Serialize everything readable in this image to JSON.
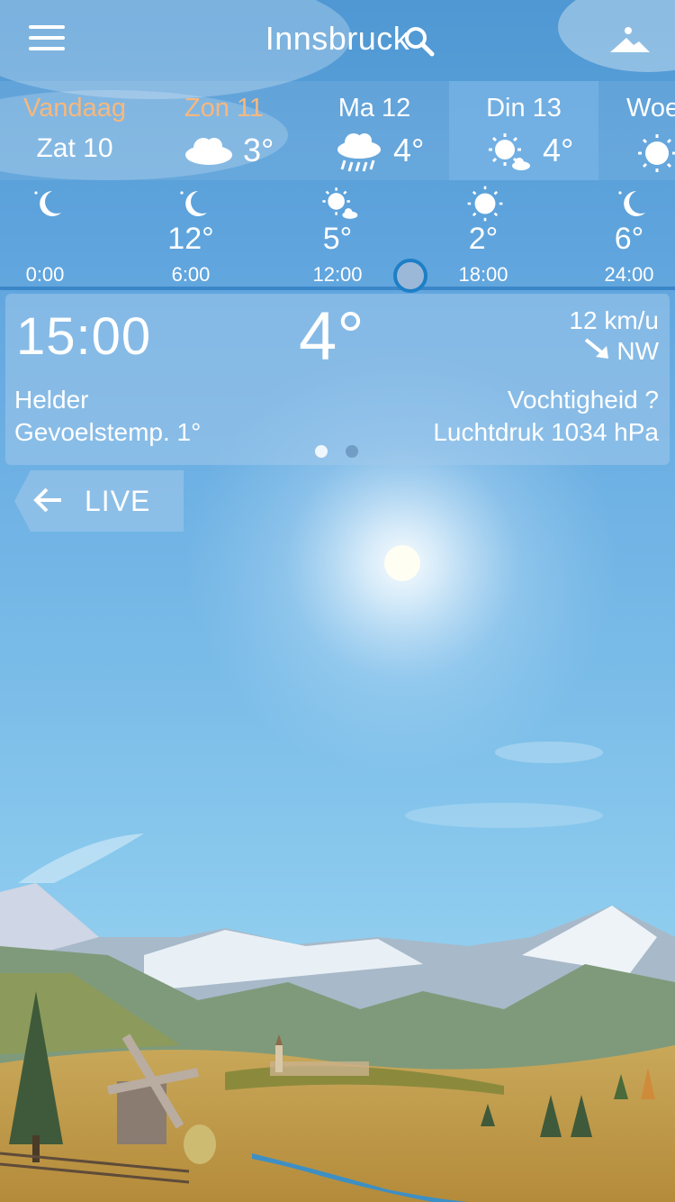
{
  "app": {
    "city": "Innsbruck"
  },
  "days": [
    {
      "name": "Vandaag",
      "sub": "Zat 10",
      "icon": "none",
      "temp": "",
      "highlight": "orange"
    },
    {
      "name": "Zon 11",
      "icon": "cloud-icon",
      "temp": "3°",
      "highlight": "orange"
    },
    {
      "name": "Ma 12",
      "icon": "rain-cloud-icon",
      "temp": "4°",
      "highlight": "none"
    },
    {
      "name": "Din 13",
      "icon": "sun-cloud-icon",
      "temp": "4°",
      "highlight": "selected"
    },
    {
      "name": "Woe",
      "icon": "sun-icon",
      "temp": "",
      "highlight": "none"
    }
  ],
  "hours": [
    {
      "time": "0:00",
      "temp": "",
      "icon": "moon-icon"
    },
    {
      "time": "6:00",
      "temp": "12°",
      "icon": "moon-icon"
    },
    {
      "time": "12:00",
      "temp": "5°",
      "icon": "sun-cloud-icon"
    },
    {
      "time": "18:00",
      "temp": "2°",
      "icon": "sun-icon"
    },
    {
      "time": "24:00",
      "temp": "6°",
      "icon": "moon-icon"
    }
  ],
  "detail": {
    "time": "15:00",
    "temp": "4°",
    "wind_speed": "12 km/u",
    "wind_dir": "NW",
    "condition": "Helder",
    "feels_like": "Gevoelstemp. 1°",
    "humidity": "Vochtigheid ?",
    "pressure": "Luchtdruk 1034 hPa",
    "page_index": 1,
    "page_count": 2
  },
  "live_button": {
    "label": "LIVE"
  },
  "colors": {
    "accent_orange": "#f6b87d",
    "selected_day": "#78b4e6",
    "timeline": "#3a86c8",
    "knob_border": "#1d7fc6"
  }
}
